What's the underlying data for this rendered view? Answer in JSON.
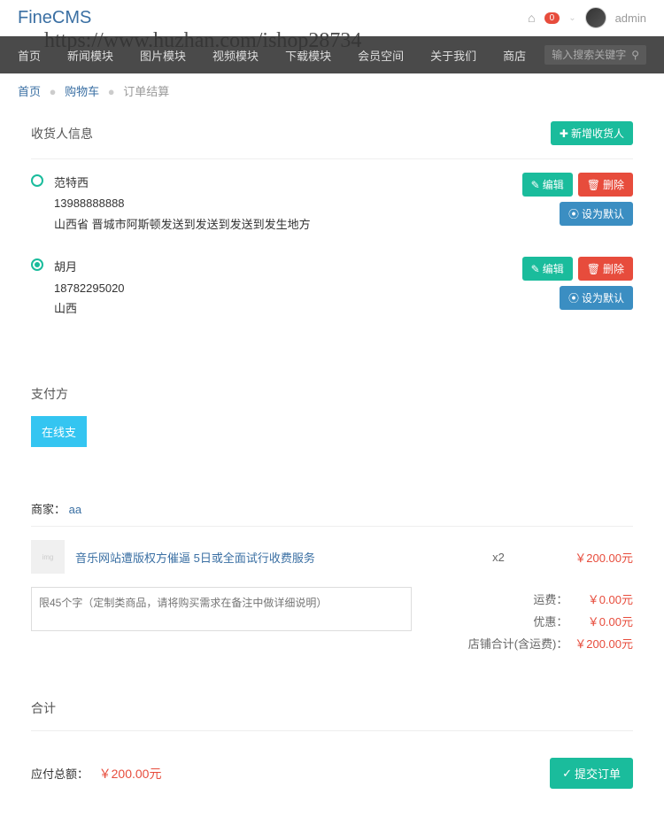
{
  "header": {
    "logo": "FineCMS",
    "cart_count": "0",
    "username": "admin",
    "watermark": "https://www.huzhan.com/ishop28734"
  },
  "nav": {
    "items": [
      "首页",
      "新闻模块",
      "图片模块",
      "视频模块",
      "下载模块",
      "会员空间",
      "关于我们",
      "商店"
    ],
    "search_placeholder": "输入搜索关键字"
  },
  "breadcrumb": {
    "home": "首页",
    "cart": "购物车",
    "current": "订单结算"
  },
  "shipping": {
    "title": "收货人信息",
    "add_button": "新增收货人",
    "edit_label": "编辑",
    "delete_label": "删除",
    "default_label": "设为默认",
    "addresses": [
      {
        "name": "范特西",
        "phone": "13988888888",
        "address": "山西省 晋城市阿斯顿发送到发送到发送到发生地方"
      },
      {
        "name": "胡月",
        "phone": "18782295020",
        "address": "山西"
      }
    ]
  },
  "payment": {
    "title": "支付方",
    "online_label": "在线支"
  },
  "order": {
    "merchant_label": "商家：",
    "merchant_name": "aa",
    "product_name": "音乐网站遭版权方催逼 5日或全面试行收费服务",
    "product_qty": "x2",
    "product_price": "￥200.00元",
    "remark_placeholder": "限45个字（定制类商品，请将购买需求在备注中做详细说明）",
    "shipping_label": "运费：",
    "shipping_value": "￥0.00元",
    "discount_label": "优惠：",
    "discount_value": "￥0.00元",
    "subtotal_label": "店铺合计(含运费)：",
    "subtotal_value": "￥200.00元"
  },
  "summary": {
    "title": "合计",
    "total_label": "应付总额：",
    "total_value": "￥200.00元",
    "submit_label": "提交订单"
  }
}
